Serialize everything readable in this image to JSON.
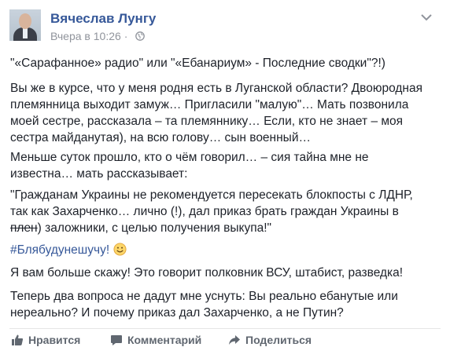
{
  "post": {
    "author": "Вячеслав Лунгу",
    "time": "Вчера в 10:26",
    "separator": "·",
    "paragraphs": {
      "p1": "\"«Сарафанное» радио\" или \"«Ебанариум» - Последние сводки\"?!)",
      "p2": [
        "Вы же в курсе, что у меня родня есть в Луганской области? Двоюродная",
        "племянница выходит замуж… Пригласили \"малую\"… Мать позвонила",
        "моей сестре, рассказала – та племяннику… Если, кто не знает – моя",
        "сестра майданутая), на всю голову… сын военный…"
      ],
      "p3": [
        "Меньше суток прошло, кто о чём говорил… – сия тайна мне не",
        "известна… мать рассказывает:"
      ],
      "p4": [
        "\"Гражданам Украины не рекомендуется пересекать блокпосты с ЛДНР,",
        "так как Захарченко… лично (!), дал приказ брать граждан Украины в"
      ],
      "p4_strike": "плен",
      "p4_rest": ") заложники, с целью получения выкупа!\"",
      "hashtag": "#Блябудунешучу!",
      "p6": "Я вам больше скажу! Это говорит полковник ВСУ, штабист, разведка!",
      "p7": [
        "Теперь два вопроса не дадут мне уснуть: Вы реально ебанутые или",
        "нереально? И почему приказ дал Захарченко, а не Путин?"
      ]
    }
  },
  "actions": {
    "like": "Нравится",
    "comment": "Комментарий",
    "share": "Поделиться"
  },
  "colors": {
    "link": "#365899",
    "text": "#1d2129",
    "meta": "#90949c",
    "action": "#606770"
  },
  "icons": {
    "avatar": "profile-photo",
    "privacy": "globe-icon",
    "menu": "chevron-down-icon",
    "emoji": "smiley-icon",
    "like": "thumbs-up-icon",
    "comment": "comment-icon",
    "share": "share-icon"
  }
}
